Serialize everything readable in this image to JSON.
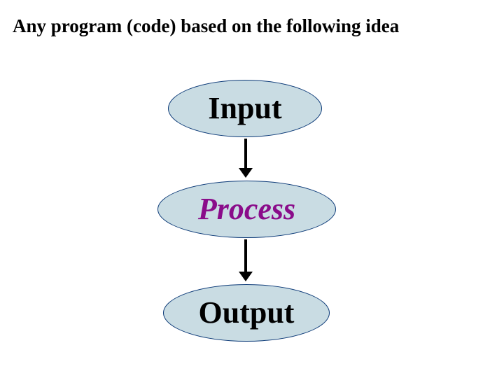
{
  "heading": "Any program (code) based on the following idea",
  "nodes": {
    "input": "Input",
    "process": "Process",
    "output": "Output"
  },
  "colors": {
    "ellipse_fill": "#c9dce3",
    "ellipse_stroke": "#0b3977",
    "process_text": "#8a0c8a",
    "default_text": "#000000"
  }
}
